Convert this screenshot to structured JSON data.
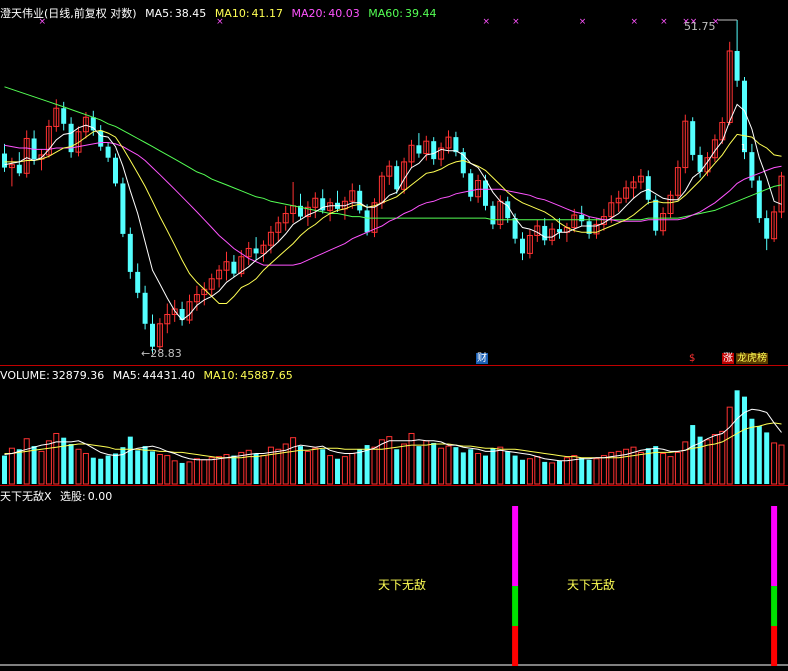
{
  "colors": {
    "bg": "#000000",
    "up": "#ff3232",
    "down": "#54ffff",
    "ma5": "#ffffff",
    "ma10": "#ffff54",
    "ma20": "#ff54ff",
    "ma60": "#54ff54",
    "separator": "#c00000",
    "text": "#ffffff",
    "axis_note": "#c0c0c0",
    "marker": "#ff54ff"
  },
  "price_panel": {
    "name": "澄天伟业",
    "mode": "(日线,前复权 对数)",
    "ma5_label": "MA5:",
    "ma5_value": "38.45",
    "ma10_label": "MA10:",
    "ma10_value": "41.17",
    "ma20_label": "MA20:",
    "ma20_value": "40.03",
    "ma60_label": "MA60:",
    "ma60_value": "39.44",
    "high_note": "51.75",
    "low_note": "28.83",
    "badge_cai": "财",
    "badge_dollar": "$",
    "badge_zhang": "涨",
    "badge_longhu": "龙虎榜",
    "marker_glyph": "×",
    "small_glyph": "1"
  },
  "volume_panel": {
    "vol_label": "VOLUME:",
    "vol_value": "32879.36",
    "ma5_label": "MA5:",
    "ma5_value": "44431.40",
    "ma10_label": "MA10:",
    "ma10_value": "45887.65"
  },
  "indicator_panel": {
    "title": "天下无敌X",
    "sel_label": "选股:",
    "sel_value": "0.00",
    "signal_label": "天下无敌"
  },
  "chart_data": {
    "type": "candlestick",
    "price_scale": "log",
    "high": 51.75,
    "low": 28.83,
    "ohlc": [
      [
        40.9,
        41.6,
        39.6,
        39.9
      ],
      [
        39.9,
        40.6,
        38.6,
        40.1
      ],
      [
        40.1,
        41.0,
        39.3,
        39.5
      ],
      [
        39.5,
        42.6,
        39.2,
        42.0
      ],
      [
        42.0,
        42.6,
        40.1,
        40.5
      ],
      [
        40.5,
        41.2,
        39.7,
        40.8
      ],
      [
        40.8,
        43.4,
        40.6,
        42.9
      ],
      [
        42.9,
        45.0,
        42.5,
        44.3
      ],
      [
        44.3,
        44.8,
        42.6,
        43.1
      ],
      [
        43.1,
        43.6,
        40.6,
        41.0
      ],
      [
        41.0,
        42.9,
        40.7,
        42.5
      ],
      [
        42.5,
        44.0,
        42.0,
        43.6
      ],
      [
        43.6,
        44.1,
        42.2,
        42.6
      ],
      [
        42.6,
        43.0,
        41.1,
        41.4
      ],
      [
        41.4,
        41.7,
        40.3,
        40.6
      ],
      [
        40.6,
        40.9,
        38.6,
        38.8
      ],
      [
        38.8,
        39.2,
        35.3,
        35.5
      ],
      [
        35.5,
        35.9,
        32.8,
        33.2
      ],
      [
        33.2,
        33.7,
        31.7,
        32.0
      ],
      [
        32.0,
        32.4,
        30.0,
        30.3
      ],
      [
        30.3,
        30.8,
        28.83,
        29.1
      ],
      [
        29.1,
        30.6,
        28.9,
        30.3
      ],
      [
        30.3,
        31.4,
        29.8,
        30.8
      ],
      [
        30.8,
        31.6,
        30.4,
        31.1
      ],
      [
        31.1,
        31.5,
        30.2,
        30.5
      ],
      [
        30.5,
        31.9,
        30.3,
        31.5
      ],
      [
        31.5,
        32.4,
        31.0,
        31.9
      ],
      [
        31.9,
        32.6,
        31.3,
        32.2
      ],
      [
        32.2,
        33.1,
        31.8,
        32.8
      ],
      [
        32.8,
        33.6,
        32.3,
        33.3
      ],
      [
        33.3,
        34.4,
        32.7,
        33.8
      ],
      [
        33.8,
        34.2,
        32.9,
        33.1
      ],
      [
        33.1,
        34.5,
        32.9,
        34.1
      ],
      [
        34.1,
        35.0,
        33.6,
        34.6
      ],
      [
        34.6,
        35.3,
        33.9,
        34.3
      ],
      [
        34.3,
        35.1,
        33.8,
        34.8
      ],
      [
        34.8,
        36.0,
        34.3,
        35.6
      ],
      [
        35.6,
        36.6,
        35.0,
        36.2
      ],
      [
        36.2,
        37.3,
        35.7,
        36.8
      ],
      [
        36.8,
        38.9,
        36.2,
        37.3
      ],
      [
        37.3,
        38.1,
        36.4,
        36.6
      ],
      [
        36.6,
        37.6,
        36.0,
        37.2
      ],
      [
        37.2,
        38.2,
        36.5,
        37.8
      ],
      [
        37.8,
        38.4,
        36.8,
        37.0
      ],
      [
        37.0,
        37.8,
        36.3,
        37.5
      ],
      [
        37.5,
        38.3,
        36.9,
        37.1
      ],
      [
        37.1,
        37.9,
        36.4,
        37.6
      ],
      [
        37.6,
        38.8,
        37.1,
        38.3
      ],
      [
        38.3,
        38.7,
        36.8,
        37.0
      ],
      [
        37.0,
        37.4,
        35.4,
        35.6
      ],
      [
        35.6,
        37.8,
        35.3,
        37.5
      ],
      [
        37.5,
        39.6,
        37.1,
        39.3
      ],
      [
        39.3,
        40.4,
        38.7,
        40.0
      ],
      [
        40.0,
        40.4,
        38.1,
        38.4
      ],
      [
        38.4,
        40.6,
        38.1,
        40.3
      ],
      [
        40.3,
        41.9,
        39.9,
        41.5
      ],
      [
        41.5,
        42.4,
        40.6,
        40.9
      ],
      [
        40.9,
        42.2,
        40.4,
        41.8
      ],
      [
        41.8,
        42.1,
        40.1,
        40.5
      ],
      [
        40.5,
        41.7,
        40.0,
        41.3
      ],
      [
        41.3,
        42.6,
        40.9,
        42.1
      ],
      [
        42.1,
        42.5,
        40.7,
        41.0
      ],
      [
        41.0,
        41.3,
        39.2,
        39.5
      ],
      [
        39.5,
        39.8,
        37.6,
        37.9
      ],
      [
        37.9,
        39.4,
        37.5,
        39.0
      ],
      [
        39.0,
        39.4,
        37.0,
        37.3
      ],
      [
        37.3,
        37.6,
        35.8,
        36.1
      ],
      [
        36.1,
        38.0,
        35.8,
        37.6
      ],
      [
        37.6,
        37.9,
        36.2,
        36.5
      ],
      [
        36.5,
        36.8,
        34.9,
        35.2
      ],
      [
        35.2,
        35.6,
        33.9,
        34.3
      ],
      [
        34.3,
        35.8,
        34.0,
        35.4
      ],
      [
        35.4,
        36.4,
        35.0,
        36.0
      ],
      [
        36.0,
        36.5,
        34.8,
        35.1
      ],
      [
        35.1,
        36.2,
        34.8,
        35.8
      ],
      [
        35.8,
        36.5,
        35.2,
        35.6
      ],
      [
        35.6,
        36.2,
        35.0,
        35.9
      ],
      [
        35.9,
        37.1,
        35.6,
        36.7
      ],
      [
        36.7,
        37.3,
        36.0,
        36.3
      ],
      [
        36.3,
        36.6,
        35.2,
        35.5
      ],
      [
        35.5,
        36.5,
        35.2,
        36.1
      ],
      [
        36.1,
        37.1,
        35.7,
        36.6
      ],
      [
        36.6,
        38.0,
        36.2,
        37.5
      ],
      [
        37.5,
        38.3,
        36.9,
        37.8
      ],
      [
        37.8,
        39.0,
        37.5,
        38.5
      ],
      [
        38.5,
        39.3,
        37.8,
        38.9
      ],
      [
        38.9,
        39.8,
        38.4,
        39.3
      ],
      [
        39.3,
        39.7,
        37.4,
        37.7
      ],
      [
        37.7,
        38.0,
        35.4,
        35.7
      ],
      [
        35.7,
        37.2,
        35.4,
        36.8
      ],
      [
        36.8,
        38.3,
        36.5,
        38.0
      ],
      [
        38.0,
        40.4,
        37.7,
        39.9
      ],
      [
        39.9,
        43.8,
        39.5,
        43.3
      ],
      [
        43.3,
        43.6,
        40.4,
        40.8
      ],
      [
        40.8,
        41.4,
        39.2,
        39.6
      ],
      [
        39.6,
        41.0,
        39.3,
        40.6
      ],
      [
        40.6,
        42.3,
        40.3,
        41.9
      ],
      [
        41.9,
        43.6,
        41.6,
        43.2
      ],
      [
        43.2,
        49.8,
        43.0,
        49.0
      ],
      [
        49.0,
        51.75,
        46.0,
        46.5
      ],
      [
        46.5,
        46.8,
        40.5,
        41.0
      ],
      [
        41.0,
        41.6,
        38.5,
        39.0
      ],
      [
        39.0,
        39.3,
        36.2,
        36.5
      ],
      [
        36.5,
        37.0,
        34.5,
        35.2
      ],
      [
        35.2,
        37.3,
        35.0,
        36.9
      ],
      [
        36.9,
        39.6,
        36.5,
        39.3
      ]
    ],
    "ma5": [
      40.1,
      40.2,
      40.3,
      40.6,
      40.4,
      40.6,
      41.2,
      41.9,
      42.3,
      42.4,
      42.8,
      43.0,
      42.8,
      42.2,
      42.1,
      41.4,
      40.0,
      38.3,
      36.8,
      35.0,
      33.3,
      32.5,
      31.7,
      31.0,
      30.5,
      30.8,
      31.3,
      31.6,
      31.8,
      32.1,
      32.6,
      32.9,
      33.2,
      33.5,
      33.9,
      34.2,
      34.6,
      35.0,
      35.5,
      36.1,
      36.4,
      36.7,
      36.9,
      37.2,
      37.3,
      37.3,
      37.3,
      37.5,
      37.5,
      37.2,
      37.2,
      37.5,
      38.0,
      38.2,
      39.1,
      39.9,
      40.2,
      40.8,
      40.9,
      41.2,
      41.1,
      41.1,
      40.8,
      40.2,
      39.9,
      39.1,
      38.2,
      37.6,
      37.3,
      36.5,
      35.9,
      35.8,
      35.6,
      35.3,
      35.3,
      35.6,
      35.6,
      35.8,
      36.0,
      36.0,
      36.0,
      36.2,
      36.5,
      36.8,
      37.3,
      37.8,
      38.2,
      38.4,
      38.1,
      37.8,
      37.7,
      37.7,
      38.3,
      39.2,
      39.6,
      40.3,
      41.1,
      41.8,
      43.3,
      44.6,
      44.1,
      42.7,
      40.6,
      39.2,
      37.6,
      37.4
    ],
    "ma10": [
      40.3,
      40.3,
      40.3,
      40.4,
      40.4,
      40.5,
      40.7,
      41.0,
      41.3,
      41.4,
      41.7,
      42.1,
      42.5,
      42.6,
      42.4,
      42.1,
      41.3,
      40.4,
      39.5,
      38.6,
      37.6,
      36.6,
      35.7,
      34.8,
      33.9,
      33.1,
      32.6,
      32.2,
      31.8,
      31.4,
      31.4,
      31.8,
      32.3,
      32.5,
      32.8,
      33.3,
      33.7,
      34.1,
      34.5,
      34.9,
      35.4,
      35.8,
      36.1,
      36.5,
      36.8,
      37.0,
      37.1,
      37.3,
      37.4,
      37.2,
      37.3,
      37.5,
      37.7,
      37.9,
      38.3,
      38.7,
      39.1,
      39.5,
      39.6,
      39.8,
      40.1,
      40.3,
      40.4,
      40.2,
      40.0,
      39.7,
      39.2,
      38.7,
      38.2,
      37.8,
      37.5,
      37.3,
      37.1,
      36.9,
      36.6,
      36.2,
      35.9,
      35.7,
      35.6,
      35.6,
      35.6,
      35.8,
      36.0,
      36.2,
      36.4,
      36.7,
      37.1,
      37.5,
      37.6,
      37.5,
      37.5,
      37.6,
      38.0,
      38.5,
      39.0,
      39.6,
      40.2,
      40.8,
      41.6,
      42.3,
      42.2,
      42.1,
      41.6,
      41.3,
      40.8,
      40.7
    ],
    "ma20": [
      41.5,
      41.4,
      41.3,
      41.3,
      41.2,
      41.2,
      41.2,
      41.3,
      41.3,
      41.3,
      41.4,
      41.5,
      41.6,
      41.7,
      41.7,
      41.6,
      41.4,
      41.1,
      40.8,
      40.4,
      39.9,
      39.4,
      38.9,
      38.4,
      37.9,
      37.4,
      36.9,
      36.4,
      35.9,
      35.4,
      35.0,
      34.6,
      34.3,
      34.0,
      33.8,
      33.6,
      33.6,
      33.6,
      33.6,
      33.6,
      33.7,
      33.9,
      34.1,
      34.3,
      34.5,
      34.7,
      34.9,
      35.2,
      35.4,
      35.6,
      35.8,
      36.0,
      36.3,
      36.5,
      36.8,
      37.0,
      37.3,
      37.5,
      37.6,
      37.8,
      37.9,
      38.1,
      38.2,
      38.3,
      38.4,
      38.4,
      38.4,
      38.4,
      38.3,
      38.2,
      38.1,
      38.0,
      37.8,
      37.7,
      37.5,
      37.3,
      37.1,
      36.9,
      36.8,
      36.6,
      36.5,
      36.4,
      36.4,
      36.3,
      36.3,
      36.3,
      36.3,
      36.4,
      36.4,
      36.4,
      36.4,
      36.4,
      36.5,
      36.7,
      36.9,
      37.2,
      37.5,
      37.9,
      38.3,
      38.8,
      39.1,
      39.3,
      39.5,
      39.7,
      39.9,
      40.0
    ],
    "ma60": [
      46.0,
      45.8,
      45.6,
      45.4,
      45.2,
      45.0,
      44.8,
      44.6,
      44.4,
      44.2,
      44.0,
      43.8,
      43.6,
      43.4,
      43.1,
      42.9,
      42.6,
      42.3,
      42.0,
      41.7,
      41.4,
      41.1,
      40.8,
      40.5,
      40.2,
      39.9,
      39.6,
      39.4,
      39.1,
      38.9,
      38.7,
      38.5,
      38.3,
      38.1,
      37.9,
      37.8,
      37.6,
      37.5,
      37.4,
      37.3,
      37.2,
      37.1,
      37.0,
      36.9,
      36.8,
      36.8,
      36.7,
      36.6,
      36.6,
      36.5,
      36.5,
      36.5,
      36.5,
      36.5,
      36.5,
      36.5,
      36.5,
      36.5,
      36.5,
      36.5,
      36.5,
      36.5,
      36.5,
      36.5,
      36.5,
      36.5,
      36.4,
      36.4,
      36.4,
      36.4,
      36.4,
      36.4,
      36.4,
      36.4,
      36.4,
      36.4,
      36.4,
      36.4,
      36.4,
      36.4,
      36.4,
      36.4,
      36.4,
      36.4,
      36.4,
      36.4,
      36.4,
      36.5,
      36.5,
      36.5,
      36.5,
      36.5,
      36.6,
      36.7,
      36.8,
      36.9,
      37.0,
      37.2,
      37.4,
      37.6,
      37.8,
      38.0,
      38.2,
      38.4,
      38.6,
      38.7
    ],
    "volume": [
      27,
      34,
      33,
      43,
      36,
      31,
      41,
      48,
      44,
      38,
      33,
      29,
      25,
      24,
      27,
      29,
      35,
      45,
      32,
      36,
      31,
      28,
      27,
      22,
      20,
      21,
      24,
      23,
      25,
      26,
      28,
      27,
      30,
      32,
      29,
      27,
      35,
      33,
      38,
      44,
      36,
      31,
      34,
      33,
      27,
      24,
      26,
      29,
      33,
      37,
      35,
      42,
      45,
      33,
      38,
      48,
      36,
      41,
      39,
      34,
      36,
      35,
      30,
      33,
      29,
      27,
      34,
      35,
      31,
      27,
      23,
      24,
      26,
      21,
      20,
      22,
      25,
      27,
      25,
      23,
      24,
      27,
      30,
      31,
      33,
      35,
      30,
      34,
      36,
      29,
      26,
      30,
      40,
      56,
      45,
      42,
      47,
      50,
      73,
      89,
      83,
      62,
      55,
      49,
      39,
      37
    ],
    "volume_ma5": [
      28,
      29,
      31,
      33,
      35,
      37,
      38,
      40,
      40,
      40,
      41,
      38,
      34,
      30,
      28,
      27,
      28,
      32,
      34,
      35,
      36,
      34,
      31,
      29,
      26,
      24,
      23,
      23,
      23,
      24,
      25,
      26,
      27,
      28,
      29,
      29,
      30,
      31,
      32,
      35,
      37,
      36,
      35,
      36,
      32,
      30,
      29,
      29,
      30,
      32,
      34,
      38,
      41,
      41,
      41,
      41,
      42,
      41,
      41,
      40,
      37,
      37,
      35,
      34,
      33,
      31,
      31,
      32,
      31,
      30,
      29,
      28,
      26,
      24,
      23,
      22,
      22,
      23,
      24,
      24,
      25,
      25,
      26,
      27,
      28,
      30,
      32,
      33,
      34,
      33,
      31,
      31,
      32,
      36,
      39,
      43,
      46,
      48,
      54,
      62,
      68,
      71,
      70,
      68,
      58,
      49
    ],
    "volume_ma10": [
      29,
      29,
      30,
      31,
      32,
      33,
      34,
      35,
      36,
      37,
      38,
      38,
      37,
      36,
      35,
      33,
      33,
      33,
      33,
      32,
      32,
      31,
      31,
      30,
      30,
      29,
      28,
      27,
      26,
      25,
      25,
      25,
      25,
      26,
      26,
      27,
      28,
      29,
      30,
      31,
      32,
      32,
      33,
      34,
      34,
      34,
      33,
      33,
      33,
      33,
      33,
      33,
      34,
      35,
      36,
      37,
      37,
      37,
      38,
      38,
      38,
      37,
      36,
      36,
      35,
      34,
      34,
      33,
      33,
      33,
      32,
      31,
      30,
      29,
      28,
      27,
      26,
      26,
      25,
      25,
      25,
      25,
      25,
      25,
      26,
      27,
      28,
      29,
      30,
      30,
      30,
      31,
      32,
      34,
      35,
      37,
      38,
      40,
      44,
      48,
      52,
      54,
      55,
      57,
      58,
      57
    ],
    "signal_indices": [
      69,
      104
    ]
  }
}
